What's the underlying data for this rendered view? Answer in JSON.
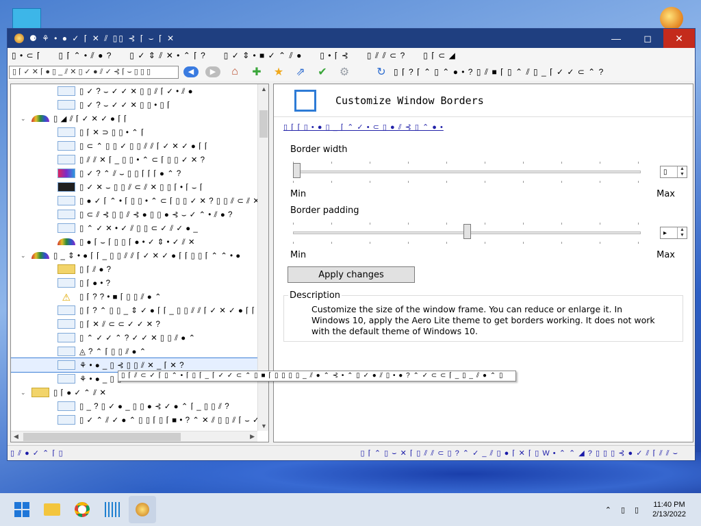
{
  "window": {
    "title": "⚈ ⚘ • ● ✓ ⌈ ✕ ⫽ ▯▯ ⊰ ⌈ ⌣ ⌈ ✕",
    "controls": {
      "minimize": "—",
      "maximize": "◻",
      "close": "✕"
    }
  },
  "menu": [
    "▯ • ⊂ ⌈",
    "▯ ⌈ ⌃ • ⫽ ● ?",
    "▯ ✓ ⇕ ⫽ ✕ • ⌃ ⌈ ?",
    "▯ ✓ ⇕ • ■ ✓ ⌃ ⫽ ●",
    "▯ • ⌈ ⊰",
    "▯ ⫽ ⫽ ⊂ ?",
    "▯ ⌈ ⊂ ◢"
  ],
  "toolbar": {
    "search_value": "▯ ⌈ ✓ ✕ ⌈ ● ▯ _ ⫽ ✕ ▯ ✓ ● ⫽ ✓ ⊰ ⌈ ⌣ ▯ ▯ ▯",
    "status_text": "▯ ⌈ ? ⌈ ⌃ ▯ ⌃ ● • ? ▯ ⫽ ■ ⌈ ▯ ⌃ ⫽ ▯ _ ⌈ ✓ ✓ ⊂ ⌃ ?",
    "icons": [
      "back-arrow-icon",
      "forward-arrow-icon",
      "home-icon",
      "add-plus-icon",
      "star-icon",
      "share-icon",
      "checkmark-icon",
      "gear-icon",
      "refresh-icon"
    ]
  },
  "tree": {
    "nodes": [
      {
        "label": "▯ ✓ ? ⌣ ✓ ✓ ✕ ▯ ▯ ⫽ ⌈ ✓ • ⫽ ●",
        "level": 2,
        "icon": "window"
      },
      {
        "label": "▯ ✓ ? ⌣ ✓ ✓ ✕ ▯ ▯ • ▯ ⌈",
        "level": 2,
        "icon": "window"
      },
      {
        "label": "▯ ◢ ⫽ ⌈ ✓ ✕ ✓ ● ⌈ ⌈",
        "level": 1,
        "icon": "category",
        "expander": "⌄"
      },
      {
        "label": "▯ ⌈ ✕ ⊃ ▯ ▯ • ⌃ ⌈",
        "level": 2,
        "icon": "window"
      },
      {
        "label": "▯ ⊂ ⌃ ▯ ▯ ✓ ▯ ▯ ⫽ ⫽ ⌈ ✓ ✕ ✓ ● ⌈ ⌈",
        "level": 2,
        "icon": "window"
      },
      {
        "label": "▯ ⫽ ⫽ ✕ ⌈ _ ▯ ▯ • ⌃ ⊂ ⌈ ▯ ▯ ✓ ✕ ?",
        "level": 2,
        "icon": "window"
      },
      {
        "label": "▯ ✓ ? ⌃ ⫽ ⌣ ▯ ▯ ⌈ ⌈ ⌈ ● ⌃ ?",
        "level": 2,
        "icon": "color"
      },
      {
        "label": "▯ ✓ ✕ ⌣ ▯ ▯ ⫽ ⊂ ⫽ ✕ ▯ ▯ ⌈ • ⌈ ⌣ ⌈",
        "level": 2,
        "icon": "dark"
      },
      {
        "label": "▯ ● ✓ ⌈ ⌃ • ⌈ ▯ ▯ • ⌃ ⊂ ⌈ ▯ ▯ ✓ ✕ ? ▯ ▯ ⫽ ⊂ ⫽ ✕",
        "level": 2,
        "icon": "window"
      },
      {
        "label": "▯ ⊂ ⫽ ⊰ ▯ ▯ ⫽ ⊰ ● ▯ ▯ ● ⊰ ⌣ ✓ ⌃ • ⫽ ● ?",
        "level": 2,
        "icon": "window"
      },
      {
        "label": "▯ ⌃ ✓ ✕ • ✓ ⫽ ▯ ▯ ⊂ ✓ ⫽ ✓ ● _",
        "level": 2,
        "icon": "window"
      },
      {
        "label": "▯ ● ⌈ ⌣ ⌈ ▯ ▯ ⌈ ● • ✓ ⇕ • ✓ ⫽ ✕",
        "level": 2,
        "icon": "category"
      },
      {
        "label": "▯ _ ⇕ • ● ⌈ ⌈ _ ▯ ▯ ⫽ ⫽ ⌈ ✓ ✕ ✓ ● ⌈ ⌈ ▯ ▯ ⌈ ⌃ ⌃ • ●",
        "level": 1,
        "icon": "category",
        "expander": "⌄"
      },
      {
        "label": "▯ ⌈ ⫽ ● ?",
        "level": 2,
        "icon": "folder"
      },
      {
        "label": "▯ ⌈ ● • ?",
        "level": 2,
        "icon": "window"
      },
      {
        "label": "▯ ⌈ ? ? • ■ ⌈ ▯ ▯ ⫽ ● ⌃",
        "level": 2,
        "icon": "warning"
      },
      {
        "label": "▯ ⌈ ? ⌃ ▯ ▯ _ ⇕ ✓ ● ⌈ ⌈ _ ▯ ▯ ⫽ ⫽ ⌈ ✓ ✕ ✓ ● ⌈ ⌈",
        "level": 2,
        "icon": "refresh"
      },
      {
        "label": "▯ ⌈ ✕ ⫽ ⊂ ⊂ ✓ ✓ ✕ ?",
        "level": 2,
        "icon": "window"
      },
      {
        "label": "▯ ⌃ ✓ ✓ ⌃ ? ✓ ✓ ✕ ▯ ▯ ⫽ ● ⌃",
        "level": 2,
        "icon": "app"
      },
      {
        "label": "◬ ? ⌃ ⌈ ▯ ▯ ⫽ ● ⌃",
        "level": 2,
        "icon": "font"
      },
      {
        "label": "⚘ • ● _ ▯ ⊰ ▯ ▯ ⫽ ✕ _ ⌈ ✕ ?",
        "level": 2,
        "icon": "window",
        "selected": true
      },
      {
        "label": "⚘ • ● _ ▯ ▯",
        "level": 2,
        "icon": "window"
      },
      {
        "label": "▯ ⌈ ● ✓ ⌃ ⫽ ✕",
        "level": 1,
        "icon": "folder",
        "expander": "⌄"
      },
      {
        "label": "▯ _ ? ▯ ✓ ● _ ▯ ▯ ● ⊰ ✓ ● ⌃ ⌈ _ ▯ ▯ ⫽ ?",
        "level": 2,
        "icon": "app"
      },
      {
        "label": "▯ ✓ ⌃ ⫽ ✓ ● ⌃ ▯ ▯ ⌈ ▯ ⌈ ■ • ? ⌃ ✕ ⫽ ▯ ▯ ⫽ ⌈ ⌣ ✓ ⫽",
        "level": 2,
        "icon": "app"
      }
    ]
  },
  "panel": {
    "title": "Customize Window Borders",
    "breadcrumb": "▯ ⌈ ⌈ ▯ • ● ▯ _ ⌈ ⌃ ✓ • ⊂ ▯ ● ⫽ ⊰ ▯ ⌃ ● •",
    "settings": [
      {
        "label": "Border width",
        "value": 0.0,
        "min_label": "Min",
        "max_label": "Max",
        "spin_value": "▯"
      },
      {
        "label": "Border padding",
        "value": 0.5,
        "min_label": "Min",
        "max_label": "Max",
        "spin_value": "▸"
      }
    ],
    "apply_label": "Apply changes",
    "description_title": "Description",
    "description_text": "Customize the size of the window frame. You can reduce or enlarge it. In Windows 10, apply the Aero Lite theme to get borders working. It does not work with the default theme of Windows 10."
  },
  "tooltip": "▯ ⌈ ⫽ ⊂ ✓ ⌈ ▯ ⌃ • ⌈ ▯ ⌈ _ ⌈ ✓ ✓ ⊂ ⌃ ▯ ■ ⌈ ▯ ▯ ▯ ▯ _ ⫽ ● ⌃ ⊰ • ⌃ ▯ ✓ ● ⫽ ▯ • ● ? ⌃ ✓ ⊂ ⊂ ⌈ _ ▯ _ ⫽ ● ⌃ ▯",
  "statusbar": {
    "left": "▯ ⫽ ● ✓ ⌃ ⌈ ▯",
    "right": "▯ ⌈ ⌃ ▯ ⌣ ✕ ⌈ ▯ ⫽ ⫽ ⊂ ▯ ? ⌃ ✓ _ ⫽ ▯ ● ⌈ ✕ ⌈ ▯ W • ⌃ ⌃ ◢ ? ▯ ▯ ▯ ⊰ ● ✓ ⫽ ⌈ ⫽ ⫽ ⌣"
  },
  "taskbar": {
    "time": "11:40 PM",
    "date": "2/13/2022",
    "apps": [
      "start-icon",
      "file-explorer-icon",
      "chrome-icon",
      "network-app-icon",
      "winaero-app-icon"
    ]
  }
}
